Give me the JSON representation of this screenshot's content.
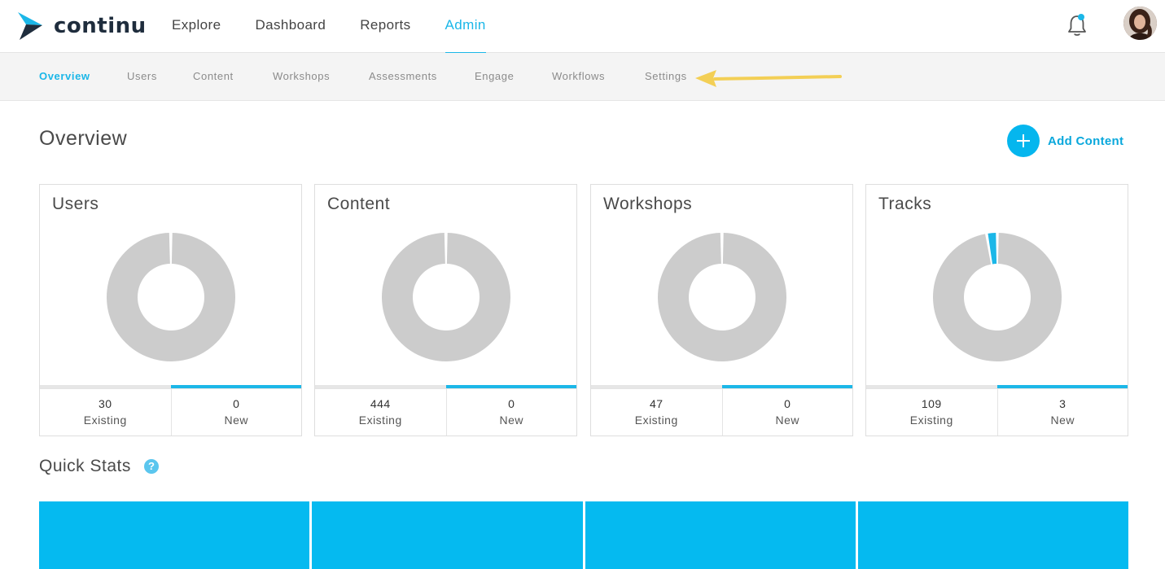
{
  "brand": {
    "name": "continu",
    "color": "#1bb7e8"
  },
  "nav": {
    "items": [
      {
        "label": "Explore",
        "active": false
      },
      {
        "label": "Dashboard",
        "active": false
      },
      {
        "label": "Reports",
        "active": false
      },
      {
        "label": "Admin",
        "active": true
      }
    ]
  },
  "subnav": {
    "items": [
      {
        "label": "Overview",
        "active": true
      },
      {
        "label": "Users",
        "active": false
      },
      {
        "label": "Content",
        "active": false
      },
      {
        "label": "Workshops",
        "active": false
      },
      {
        "label": "Assessments",
        "active": false
      },
      {
        "label": "Engage",
        "active": false
      },
      {
        "label": "Workflows",
        "active": false
      },
      {
        "label": "Settings",
        "active": false
      }
    ]
  },
  "header_icons": {
    "notifications": "bell-icon",
    "profile": "avatar"
  },
  "overview": {
    "title": "Overview",
    "add_content_label": "Add Content"
  },
  "cards": [
    {
      "title": "Users",
      "existing": "30",
      "existing_label": "Existing",
      "new": "0",
      "new_label": "New"
    },
    {
      "title": "Content",
      "existing": "444",
      "existing_label": "Existing",
      "new": "0",
      "new_label": "New"
    },
    {
      "title": "Workshops",
      "existing": "47",
      "existing_label": "Existing",
      "new": "0",
      "new_label": "New"
    },
    {
      "title": "Tracks",
      "existing": "109",
      "existing_label": "Existing",
      "new": "3",
      "new_label": "New"
    }
  ],
  "quick_stats": {
    "title": "Quick Stats",
    "help_icon": "question-icon"
  },
  "colors": {
    "accent": "#1bb7e8",
    "donut_existing": "#cccccc",
    "tile": "#05baf0",
    "annotation_arrow": "#f3cf55"
  }
}
